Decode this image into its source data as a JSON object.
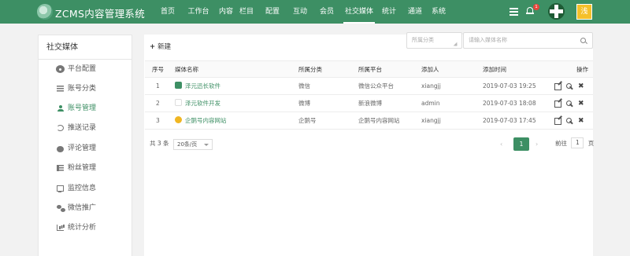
{
  "header": {
    "brand": "ZCMS内容管理系统",
    "nav": [
      "首页",
      "工作台",
      "内容",
      "栏目",
      "配置",
      "互动",
      "会员",
      "社交媒体",
      "统计",
      "通道",
      "系统"
    ],
    "active_nav": "社交媒体",
    "notification_count": "1",
    "skin_label": "浅"
  },
  "sidebar": {
    "title": "社交媒体",
    "items": [
      {
        "label": "平台配置",
        "icon": "gear-icon"
      },
      {
        "label": "账号分类",
        "icon": "list-icon"
      },
      {
        "label": "账号管理",
        "icon": "user-icon"
      },
      {
        "label": "推送记录",
        "icon": "history-icon"
      },
      {
        "label": "评论管理",
        "icon": "comment-icon"
      },
      {
        "label": "粉丝管理",
        "icon": "fans-icon"
      },
      {
        "label": "监控信息",
        "icon": "monitor-icon"
      },
      {
        "label": "微信推广",
        "icon": "wechat-icon"
      },
      {
        "label": "统计分析",
        "icon": "bar-chart-icon"
      }
    ],
    "active": "账号管理"
  },
  "toolbar": {
    "new_label": "新建",
    "category_placeholder": "所属分类",
    "search_placeholder": "请输入媒体名称"
  },
  "table": {
    "headers": [
      "序号",
      "媒体名称",
      "所属分类",
      "所属平台",
      "添加人",
      "添加时间",
      "操作"
    ],
    "rows": [
      {
        "no": "1",
        "name": "泽元迅长软件",
        "icon": "wechat-icon",
        "category": "微信",
        "platform": "微信公众平台",
        "by": "xiangjj",
        "time": "2019-07-03 19:25"
      },
      {
        "no": "2",
        "name": "泽元软件开发",
        "icon": "weibo-icon",
        "category": "微博",
        "platform": "新浪微博",
        "by": "admin",
        "time": "2019-07-03 18:08"
      },
      {
        "no": "3",
        "name": "企鹅号内容网站",
        "icon": "penguin-icon",
        "category": "企鹅号",
        "platform": "企鹅号内容网站",
        "by": "xiangjj",
        "time": "2019-07-03 17:45"
      }
    ]
  },
  "pagination": {
    "total": "共 3 条",
    "page_size": "20条/页",
    "current_page": "1",
    "goto_prefix": "前往",
    "goto_value": "1",
    "goto_suffix": "页"
  },
  "colors": {
    "header_bg": "#3d8f64",
    "accent": "#3d8f64",
    "badge": "#e8453c",
    "skin": "#f5c02a"
  }
}
